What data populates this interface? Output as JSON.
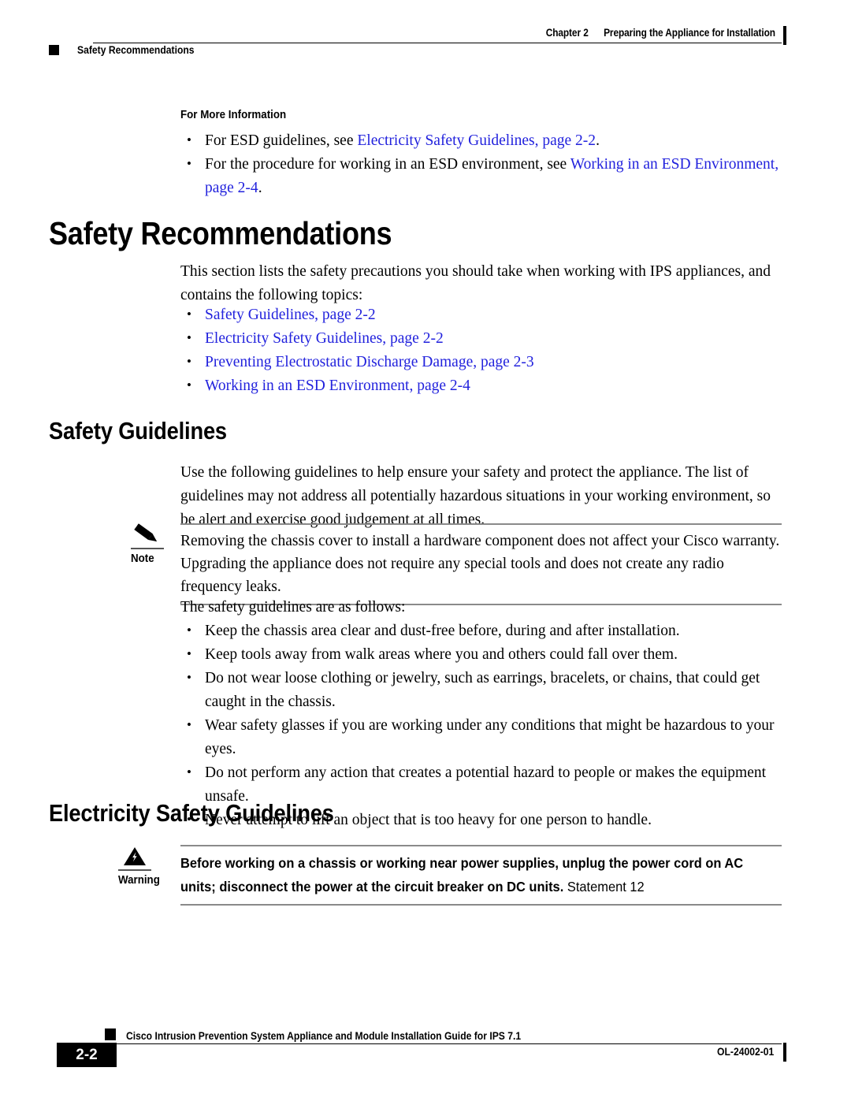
{
  "header": {
    "chapter_number": "Chapter 2",
    "chapter_title": "Preparing the Appliance for Installation",
    "running_section": "Safety Recommendations"
  },
  "more_info": {
    "heading": "For More Information",
    "items": [
      {
        "prefix": "For ESD guidelines, see ",
        "link": "Electricity Safety Guidelines, page 2-2",
        "suffix": "."
      },
      {
        "prefix": "For the procedure for working in an ESD environment, see ",
        "link": "Working in an ESD Environment, page 2-4",
        "suffix": "."
      }
    ]
  },
  "sections": {
    "safety_recommendations": {
      "title": "Safety Recommendations",
      "intro": "This section lists the safety precautions you should take when working with IPS appliances, and contains the following topics:",
      "topics": [
        "Safety Guidelines, page 2-2",
        "Electricity Safety Guidelines, page 2-2",
        "Preventing Electrostatic Discharge Damage, page 2-3",
        "Working in an ESD Environment, page 2-4"
      ]
    },
    "safety_guidelines": {
      "title": "Safety Guidelines",
      "intro": "Use the following guidelines to help ensure your safety and protect the appliance. The list of guidelines may not address all potentially hazardous situations in your working environment, so be alert and exercise good judgement at all times.",
      "note": {
        "label": "Note",
        "text": "Removing the chassis cover to install a hardware component does not affect your Cisco warranty. Upgrading the appliance does not require any special tools and does not create any radio frequency leaks."
      },
      "list_lead_in": "The safety guidelines are as follows:",
      "guidelines": [
        "Keep the chassis area clear and dust-free before, during and after installation.",
        "Keep tools away from walk areas where you and others could fall over them.",
        "Do not wear loose clothing or jewelry, such as earrings, bracelets, or chains, that could get caught in the chassis.",
        "Wear safety glasses if you are working under any conditions that might be hazardous to your eyes.",
        "Do not perform any action that creates a potential hazard to people or makes the equipment unsafe.",
        "Never attempt to lift an object that is too heavy for one person to handle."
      ]
    },
    "electricity_safety_guidelines": {
      "title": "Electricity Safety Guidelines",
      "warning": {
        "label": "Warning",
        "bold_text": "Before working on a chassis or working near power supplies, unplug the power cord on AC units; disconnect the power at the circuit breaker on DC units.",
        "statement": " Statement 12"
      }
    }
  },
  "footer": {
    "page_number": "2-2",
    "book_title": "Cisco Intrusion Prevention System Appliance and Module Installation Guide for IPS 7.1",
    "doc_id": "OL-24002-01"
  },
  "colors": {
    "link": "#2222dd",
    "text": "#000000",
    "rule": "#8a8a8a"
  },
  "icons": {
    "note": "pencil-icon",
    "warning": "warning-triangle-icon"
  }
}
